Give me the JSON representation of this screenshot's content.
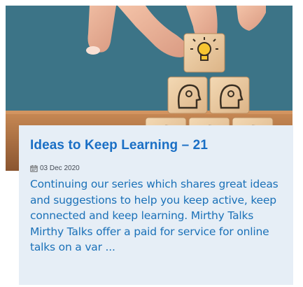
{
  "post": {
    "title": "Ideas to Keep Learning – 21",
    "date": "03 Dec 2020",
    "excerpt": "Continuing our series which shares great ideas and suggestions to help you keep active, keep connected and keep learning. Mirthy Talks Mirthy Talks offer a paid for service for online talks on a var ...",
    "image_icon": "wooden-blocks-lightbulb-image"
  },
  "colors": {
    "title": "#1a6fc5",
    "excerpt": "#1b71b8",
    "card_bg": "#e6eef6"
  }
}
